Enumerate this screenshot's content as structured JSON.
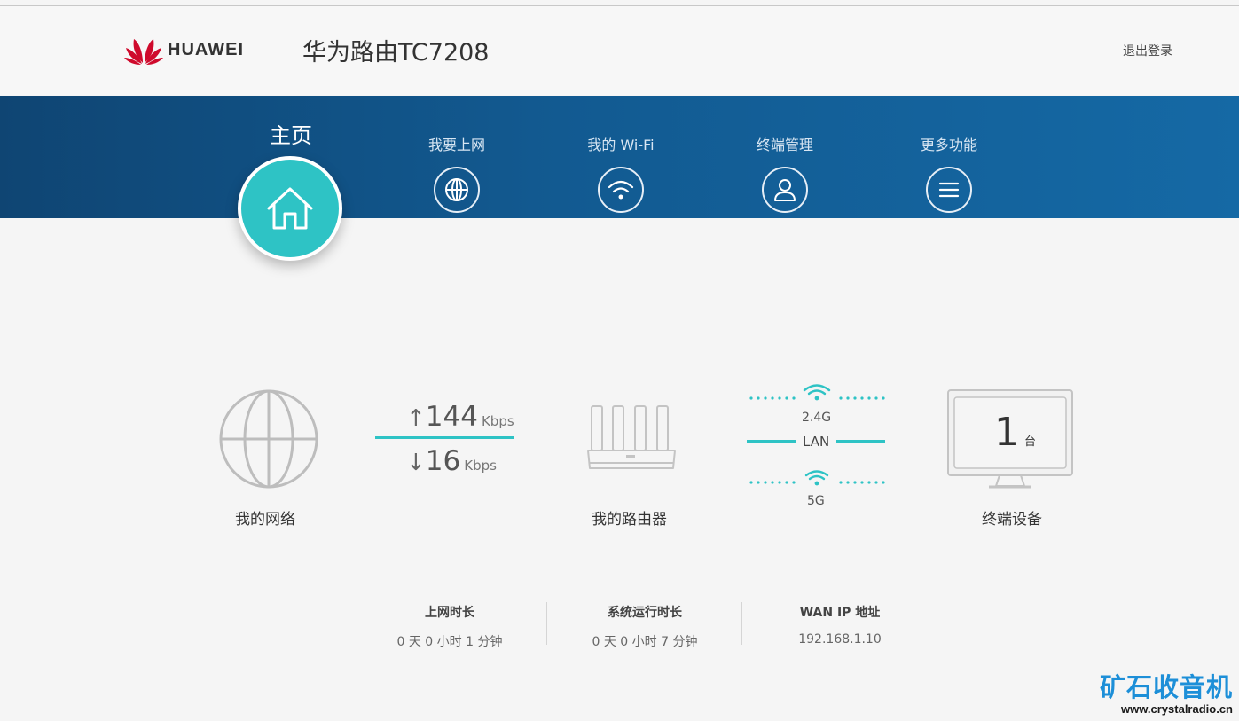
{
  "header": {
    "brand": "HUAWEI",
    "product_title": "华为路由TC7208",
    "logout": "退出登录"
  },
  "nav": {
    "home": "主页",
    "items": [
      {
        "label": "我要上网",
        "icon": "globe-icon"
      },
      {
        "label": "我的 Wi-Fi",
        "icon": "wifi-icon"
      },
      {
        "label": "终端管理",
        "icon": "user-icon"
      },
      {
        "label": "更多功能",
        "icon": "menu-icon"
      }
    ]
  },
  "status": {
    "network_label": "我的网络",
    "upload": {
      "value": "144",
      "unit": "Kbps"
    },
    "download": {
      "value": "16",
      "unit": "Kbps"
    },
    "router_label": "我的路由器",
    "band_24": "2.4G",
    "lan": "LAN",
    "band_5": "5G",
    "terminal_count": "1",
    "terminal_unit": "台",
    "terminal_label": "终端设备"
  },
  "info": [
    {
      "title": "上网时长",
      "value": "0 天 0 小时 1 分钟"
    },
    {
      "title": "系统运行时长",
      "value": "0 天 0 小时 7 分钟"
    },
    {
      "title": "WAN IP 地址",
      "value": "192.168.1.10"
    }
  ],
  "watermark": {
    "cn": "矿石收音机",
    "url": "www.crystalradio.cn"
  },
  "colors": {
    "accent": "#2ec3c5",
    "nav_band": "#125a91",
    "brand_red": "#cf0a2c",
    "watermark_blue": "#1d8fd8"
  }
}
